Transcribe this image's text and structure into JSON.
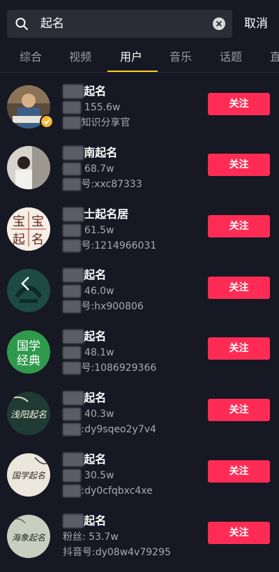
{
  "search": {
    "query": "起名",
    "cancel_label": "取消"
  },
  "tabs": [
    {
      "label": "综合",
      "active": false
    },
    {
      "label": "视频",
      "active": false
    },
    {
      "label": "用户",
      "active": true
    },
    {
      "label": "音乐",
      "active": false
    },
    {
      "label": "话题",
      "active": false
    },
    {
      "label": "直",
      "active": false
    }
  ],
  "colors": {
    "background": "#161823",
    "accent_follow": "#fe2c55",
    "tab_indicator": "#facd2c",
    "verified_badge": "#f7b535"
  },
  "users": [
    {
      "name": "起名",
      "fans": "155.6w",
      "handle": "知识分享官",
      "follow_label": "关注",
      "verified": true
    },
    {
      "name": "南起名",
      "fans": "68.7w",
      "handle": "号:xxc87333",
      "follow_label": "关注",
      "verified": false
    },
    {
      "name": "士起名居",
      "fans": "61.5w",
      "handle": "号:1214966031",
      "follow_label": "关注",
      "verified": false
    },
    {
      "name": "起名",
      "fans": "46.0w",
      "handle": "号:hx900806",
      "follow_label": "关注",
      "verified": false
    },
    {
      "name": "起名",
      "fans": "48.1w",
      "handle": "号:1086929366",
      "follow_label": "关注",
      "verified": false
    },
    {
      "name": "起名",
      "fans": "40.3w",
      "handle": ":dy9sqeo2y7v4",
      "follow_label": "关注",
      "verified": false
    },
    {
      "name": "起名",
      "fans": "30.5w",
      "handle": ":dy0cfqbxc4xe",
      "follow_label": "关注",
      "verified": false
    },
    {
      "name": "起名",
      "fans": "粉丝: 53.7w",
      "handle": "抖音号:dy08w4v79295",
      "follow_label": "关注",
      "verified": false
    }
  ],
  "avatar_texts": {
    "a3": [
      "宝",
      "宝",
      "起",
      "名"
    ],
    "a5": [
      "国学",
      "经典"
    ],
    "a6": "浅阳起名",
    "a7": "国学起名",
    "a8": "海象起名"
  }
}
